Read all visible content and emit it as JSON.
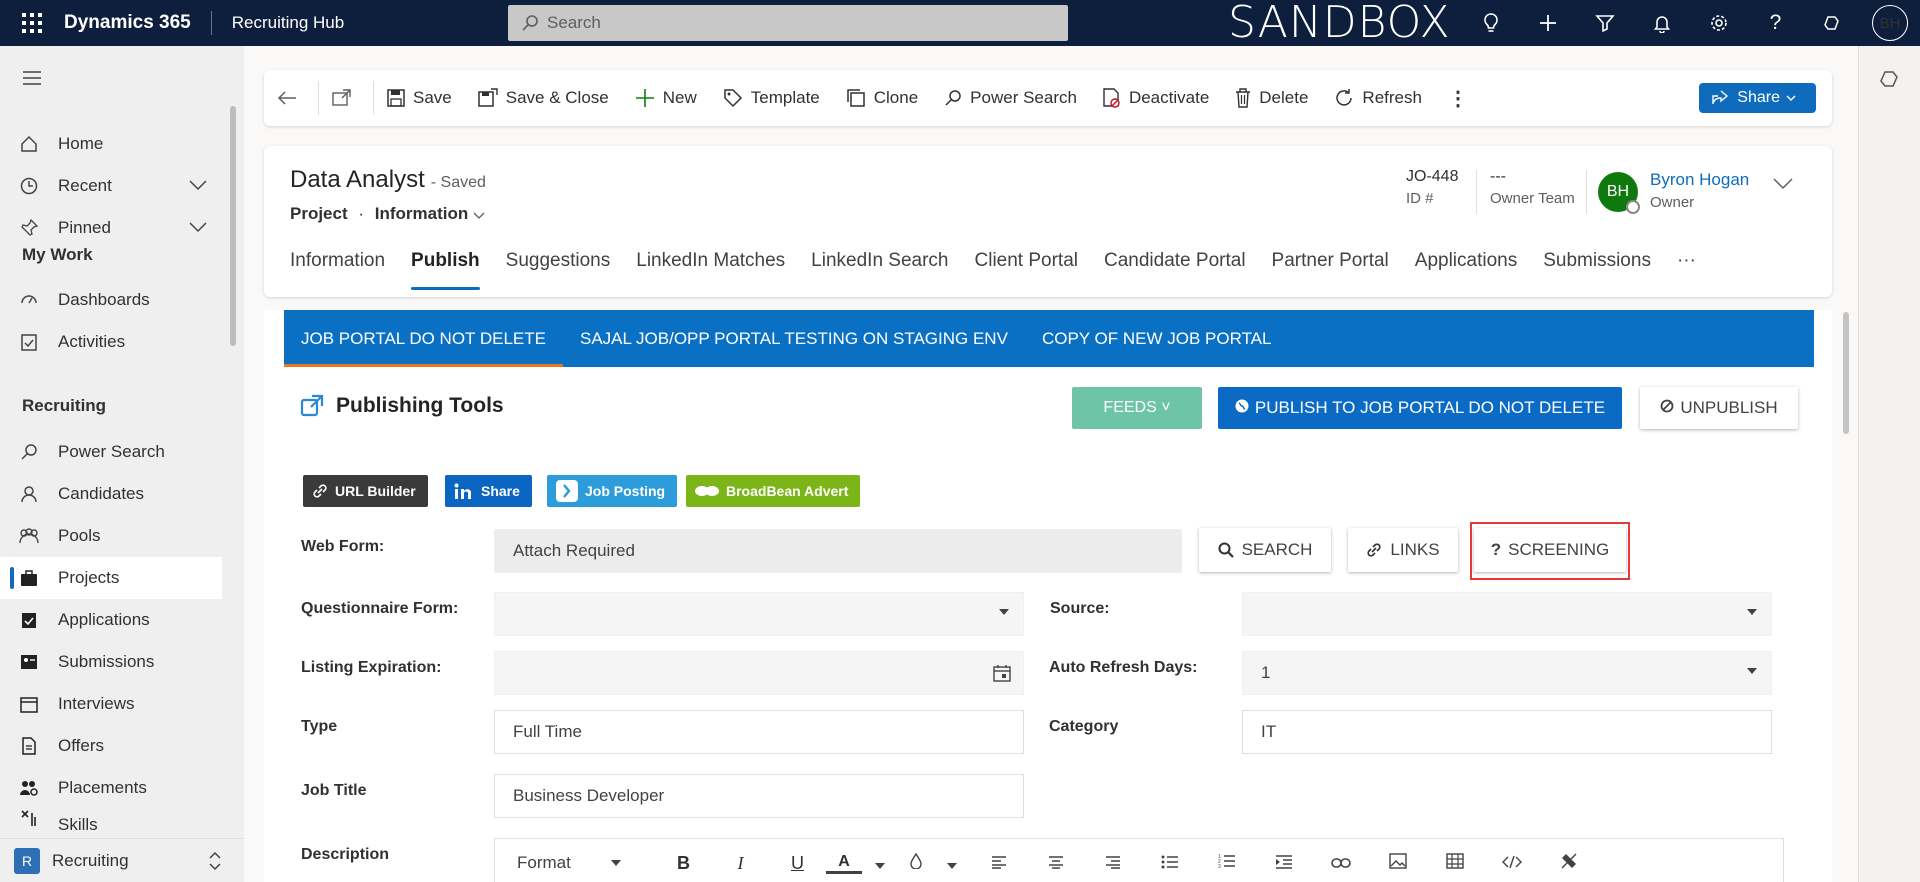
{
  "topbar": {
    "app_name": "Dynamics 365",
    "hub_name": "Recruiting Hub",
    "search_placeholder": "Search",
    "environment": "SANDBOX",
    "user_initials": "BH"
  },
  "commandbar": {
    "save": "Save",
    "save_close": "Save & Close",
    "new": "New",
    "template": "Template",
    "clone": "Clone",
    "power_search": "Power Search",
    "deactivate": "Deactivate",
    "delete": "Delete",
    "refresh": "Refresh",
    "more": "⋮",
    "share": "Share"
  },
  "leftnav": {
    "home": "Home",
    "recent": "Recent",
    "pinned": "Pinned",
    "my_work": "My Work",
    "dashboards": "Dashboards",
    "activities": "Activities",
    "recruiting": "Recruiting",
    "power_search": "Power Search",
    "candidates": "Candidates",
    "pools": "Pools",
    "projects": "Projects",
    "applications": "Applications",
    "submissions": "Submissions",
    "interviews": "Interviews",
    "offers": "Offers",
    "placements": "Placements",
    "skills": "Skills",
    "area_badge": "R",
    "area_name": "Recruiting"
  },
  "record": {
    "title": "Data Analyst",
    "status": "- Saved",
    "entity": "Project",
    "dot": "·",
    "form": "Information",
    "id_value": "JO-448",
    "id_label": "ID #",
    "team_value": "---",
    "team_label": "Owner Team",
    "owner_initials": "BH",
    "owner_name": "Byron Hogan",
    "owner_label": "Owner"
  },
  "tabs": [
    "Information",
    "Publish",
    "Suggestions",
    "LinkedIn Matches",
    "LinkedIn Search",
    "Client Portal",
    "Candidate Portal",
    "Partner Portal",
    "Applications",
    "Submissions",
    "···"
  ],
  "portal_tabs": [
    "JOB PORTAL DO NOT DELETE",
    "SAJAL JOB/OPP PORTAL TESTING ON STAGING ENV",
    "COPY OF NEW JOB PORTAL"
  ],
  "publishing": {
    "title": "Publishing Tools",
    "feeds": "FEEDS ˅",
    "publish": "PUBLISH TO JOB PORTAL DO NOT DELETE",
    "unpublish": "UNPUBLISH",
    "url_builder": "URL Builder",
    "share": "Share",
    "job_posting": "Job Posting",
    "broadbean": "BroadBean Advert"
  },
  "form": {
    "web_form_label": "Web Form:",
    "web_form_value": "Attach Required",
    "search_btn": "SEARCH",
    "links_btn": "LINKS",
    "screening_btn": "SCREENING",
    "questionnaire_label": "Questionnaire Form:",
    "questionnaire_value": "",
    "source_label": "Source:",
    "source_value": "",
    "listing_label": "Listing Expiration:",
    "listing_value": "",
    "refresh_label": "Auto Refresh Days:",
    "refresh_value": "1",
    "type_label": "Type",
    "type_value": "Full Time",
    "category_label": "Category",
    "category_value": "IT",
    "jobtitle_label": "Job Title",
    "jobtitle_value": "Business Developer",
    "description_label": "Description"
  },
  "editor": {
    "format": "Format",
    "bold": "B",
    "italic": "I",
    "underline": "U",
    "font_color": "A"
  },
  "colors": {
    "topbar": "#0d1f3c",
    "accent": "#0f6cbd",
    "portal_tabs": "#0a70c4",
    "feeds": "#6ec4a7",
    "linkedin": "#0a66c2",
    "job_posting": "#2d9cdb",
    "broadbean": "#7cb518",
    "highlight": "#e53935"
  }
}
